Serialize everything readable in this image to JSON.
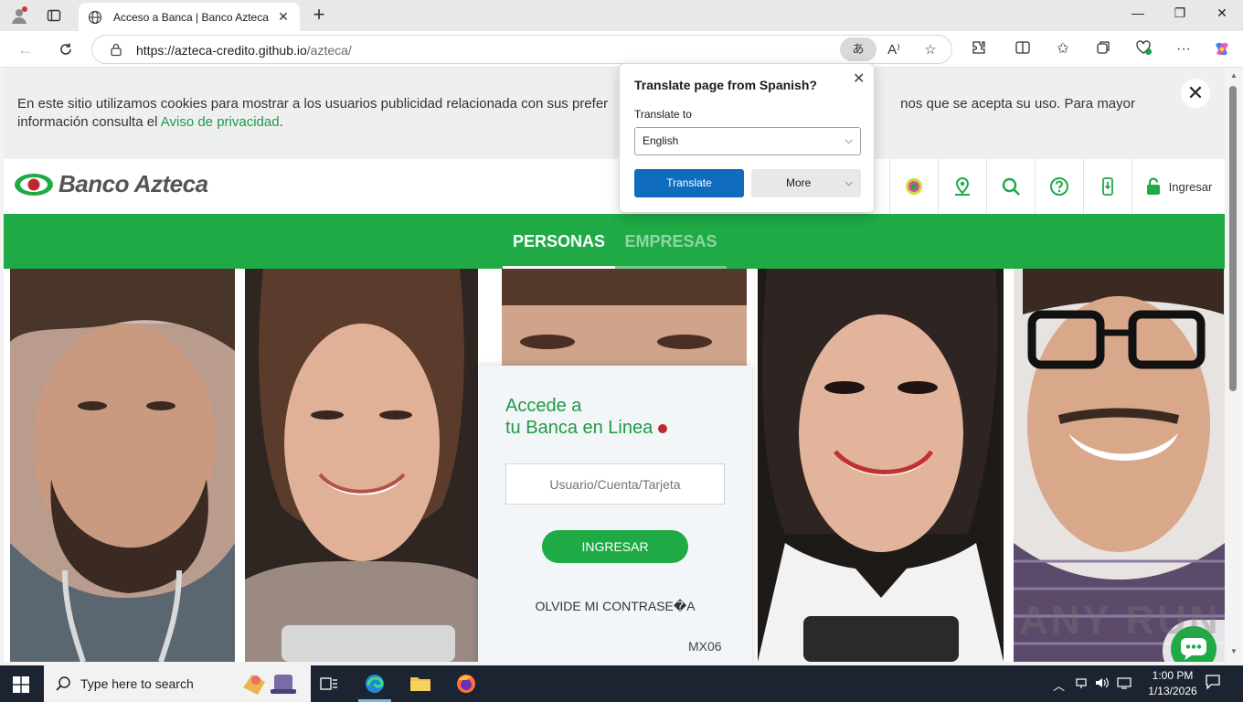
{
  "browser": {
    "tab_title": "Acceso a Banca | Banco Azteca",
    "url_host": "https://azteca-credito.github.io",
    "url_path": "/azteca/",
    "translate_glyph": "あ"
  },
  "translate_popup": {
    "title": "Translate page from Spanish?",
    "translate_to_label": "Translate to",
    "language": "English",
    "translate_button": "Translate",
    "more_button": "More"
  },
  "cookie_banner": {
    "text_before": "En este sitio utilizamos cookies para mostrar a los usuarios publicidad relacionada con sus prefer",
    "text_after": "nos que se acepta su uso. Para mayor",
    "text_line2": "información consulta el ",
    "link": "Aviso de privacidad",
    "period": "."
  },
  "site": {
    "logo_text": "Banco Azteca",
    "login_label": "Ingresar",
    "tabs": [
      {
        "label": "PERSONAS",
        "active": true
      },
      {
        "label": "EMPRESAS",
        "active": false
      }
    ]
  },
  "login_card": {
    "title_line1": "Accede a",
    "title_line2": "tu Banca en Linea",
    "input_placeholder": "Usuario/Cuenta/Tarjeta",
    "submit": "INGRESAR",
    "forgot": "OLVIDE MI CONTRASE�A",
    "code": "MX06"
  },
  "watermark": "ANY RUN",
  "taskbar": {
    "search_placeholder": "Type here to search",
    "time": "1:00 PM",
    "date": "1/13/2026"
  },
  "colors": {
    "brand_green": "#1faa46",
    "brand_red": "#c0282d",
    "edge_blue": "#0f6cbd"
  }
}
